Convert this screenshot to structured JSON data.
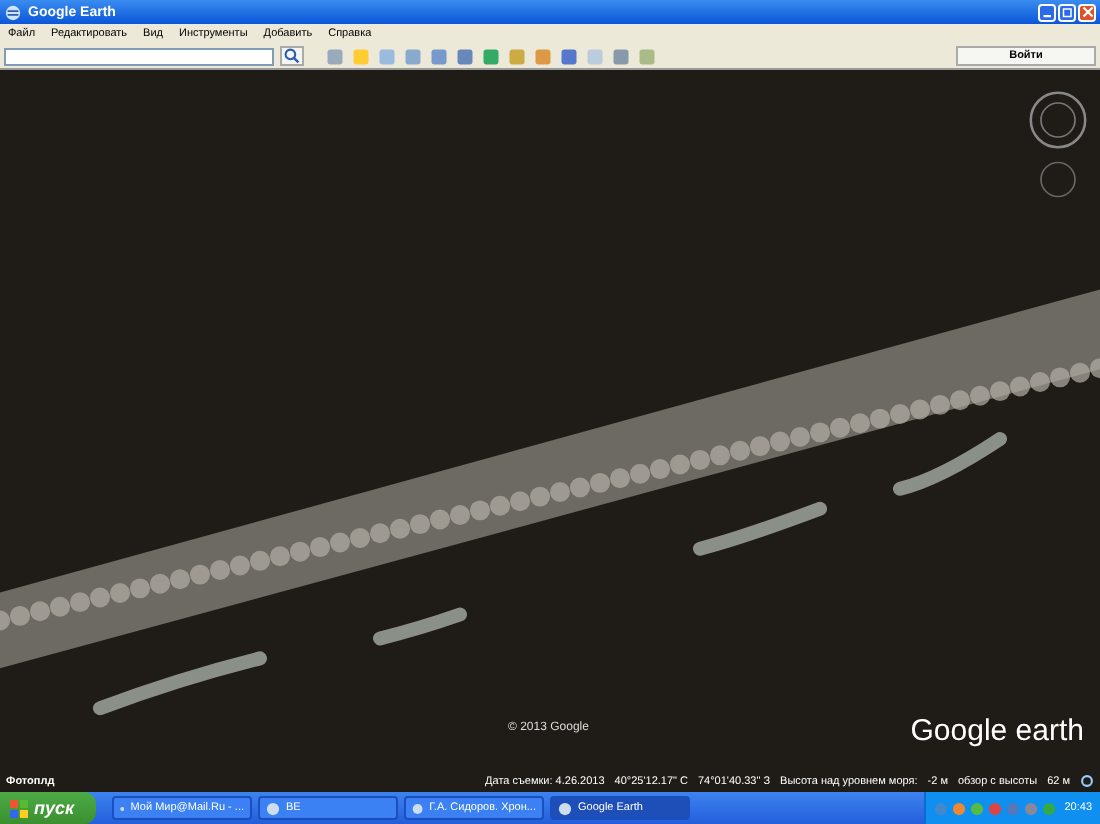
{
  "window": {
    "title": "Google Earth"
  },
  "menu": [
    "Файл",
    "Редактировать",
    "Вид",
    "Инструменты",
    "Добавить",
    "Справка"
  ],
  "toolbar": {
    "login": "Войти"
  },
  "map": {
    "copyright": "© 2013 Google",
    "logo": "Google earth",
    "layer": "Фотоплд"
  },
  "status_bar": {
    "date": "Дата съемки: 4.26.2013",
    "lat": "40°25'12.17\" С",
    "lon": "74°01'40.33\" З",
    "elevation_label": "Высота над уровнем моря:",
    "elevation": "-2 м",
    "eye_label": "обзор с высоты",
    "eye": "62 м"
  },
  "taskbar": {
    "start": "пуск",
    "tasks": [
      {
        "label": "Мой Мир@Mail.Ru - ...",
        "selected": false
      },
      {
        "label": "ВЕ",
        "selected": false
      },
      {
        "label": "Г.А. Сидоров. Хрон...",
        "selected": false
      },
      {
        "label": "Google Earth",
        "selected": true
      }
    ],
    "clock": "20:43"
  }
}
